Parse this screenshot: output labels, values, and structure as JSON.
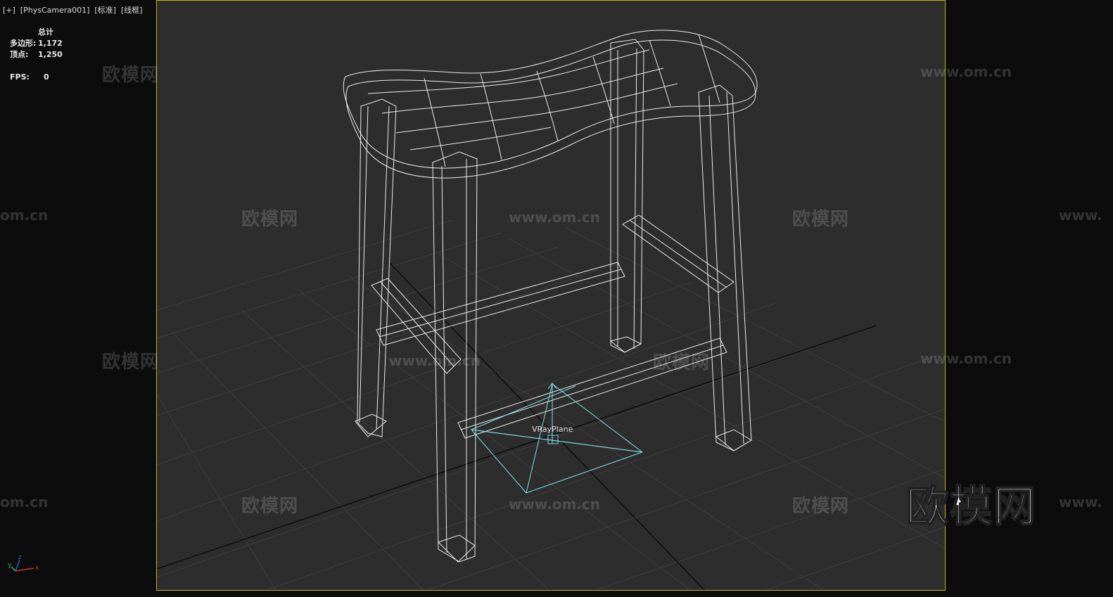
{
  "viewport": {
    "label": "[+]  [PhysCamera001]  [标准]  [线框]",
    "border_color": "#c8b400",
    "background": "#2d2d2d"
  },
  "stats": {
    "header": "总计",
    "polygons_label": "多边形:",
    "polygons_value": "1,172",
    "vertices_label": "顶点:",
    "vertices_value": "1,250",
    "fps_label": "FPS:",
    "fps_value": "0"
  },
  "scene": {
    "object_label": "VRayPlane",
    "wireframe_color": "#e8e8e8",
    "plane_color": "#7fe0e8",
    "grid_color": "#3f3f3f"
  },
  "watermarks": {
    "domain": "www.om.cn",
    "domain_partial_left": "om.cn",
    "domain_partial_right": "www.",
    "brand": "欧模网",
    "brand_large": "欧模网"
  },
  "gizmo": {
    "x_label": "x",
    "y_label": "y",
    "z_label": "z"
  }
}
